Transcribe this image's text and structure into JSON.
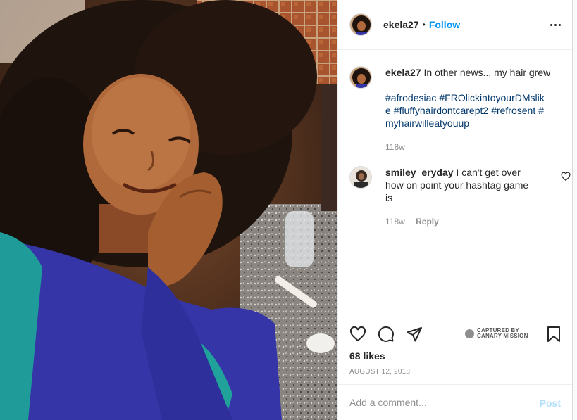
{
  "post": {
    "username": "ekela27",
    "dot": "•",
    "follow_label": "Follow",
    "more_icon": "more-horizontal-icon",
    "caption_user": "ekela27",
    "caption_text": "In other news... my hair grew",
    "hashtags": [
      "#afrodesiac",
      "#FROlickintoyourDMslike",
      "#fluffyhairdontcarept2",
      "#refrosent",
      "#myhairwilleatyouup"
    ],
    "caption_age": "118w"
  },
  "comment": {
    "username": "smiley_eryday",
    "text": "I can't get over how on point your hashtag game is",
    "age": "118w",
    "reply_label": "Reply",
    "like_icon": "heart-icon"
  },
  "actions": {
    "like_icon": "heart-icon",
    "comment_icon": "comment-bubble-icon",
    "share_icon": "paper-plane-icon",
    "save_icon": "bookmark-icon",
    "watermark_line1": "CAPTURED BY",
    "watermark_line2": "CANARY MISSION",
    "likes": "68 likes",
    "date": "AUGUST 12, 2018"
  },
  "add_comment": {
    "placeholder": "Add a comment...",
    "post_label": "Post"
  },
  "colors": {
    "link_blue": "#0095f6",
    "hashtag_blue": "#00376b",
    "muted": "#8e8e8e",
    "post_disabled": "#b2dffc"
  }
}
